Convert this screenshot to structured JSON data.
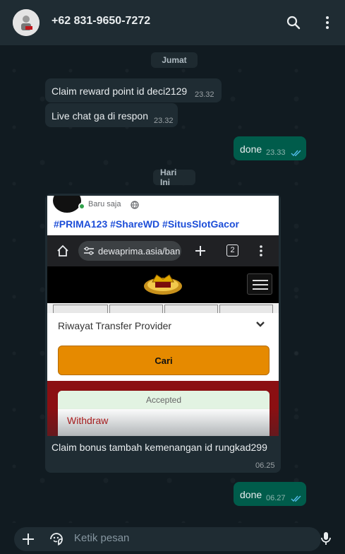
{
  "header": {
    "contact_name": "+62 831-9650-7272",
    "icons": [
      "search-icon",
      "more-vert-icon"
    ]
  },
  "chat": {
    "date_separators": [
      "Jumat",
      "Hari Ini"
    ],
    "messages": [
      {
        "dir": "in",
        "text": "Claim reward point id deci2129",
        "time": "23.32"
      },
      {
        "dir": "in",
        "text": "Live chat ga di respon",
        "time": "23.32"
      },
      {
        "dir": "out",
        "text": "done",
        "time": "23.33",
        "status": "read"
      },
      {
        "dir": "in",
        "type": "image",
        "caption": "Claim bonus tambah kemenangan id rungkad299",
        "time": "06.25"
      },
      {
        "dir": "out",
        "text": "done",
        "time": "06.27",
        "status": "read"
      }
    ]
  },
  "image_content": {
    "post_time": "Baru saja",
    "hashtags": "#PRIMA123 #ShareWD #SitusSlotGacor",
    "url": "dewaprima.asia/ban",
    "tab_count": "2",
    "dropdown_label": "Riwayat Transfer Provider",
    "search_button": "Cari",
    "status_label": "Accepted",
    "transaction_type": "Withdraw"
  },
  "composer": {
    "placeholder": "Ketik pesan"
  },
  "colors": {
    "background": "#111b21",
    "header": "#1f2c33",
    "incoming_bubble": "#1f2c33",
    "outgoing_bubble": "#005c4b",
    "read_ticks": "#53bdeb"
  }
}
